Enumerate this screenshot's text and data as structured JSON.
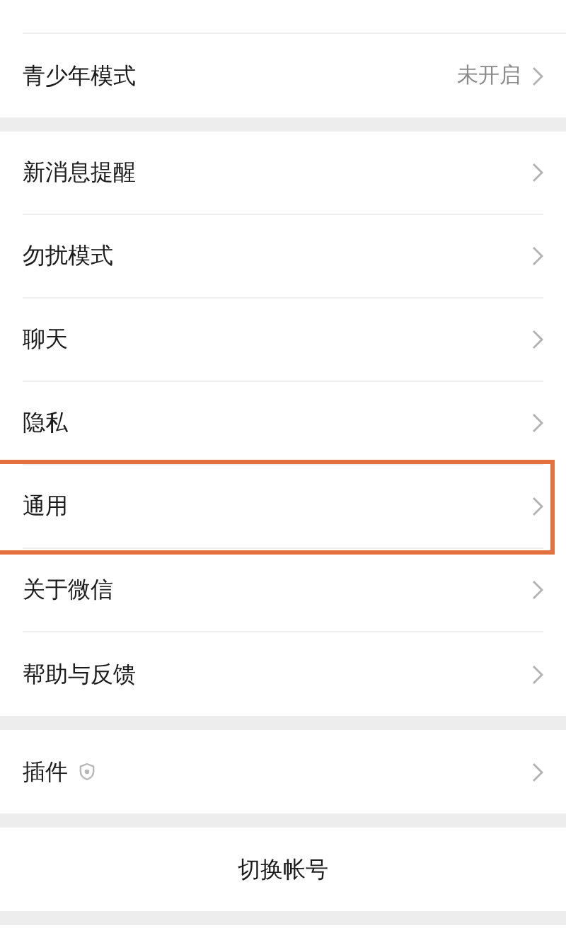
{
  "groups": [
    {
      "items": [
        {
          "kind": "link",
          "label": "青少年模式",
          "value": "未开启",
          "highlighted": false
        }
      ]
    },
    {
      "items": [
        {
          "kind": "link",
          "label": "新消息提醒",
          "highlighted": false
        },
        {
          "kind": "link",
          "label": "勿扰模式",
          "highlighted": false
        },
        {
          "kind": "link",
          "label": "聊天",
          "highlighted": false
        },
        {
          "kind": "link",
          "label": "隐私",
          "highlighted": false
        },
        {
          "kind": "link",
          "label": "通用",
          "highlighted": true
        },
        {
          "kind": "link",
          "label": "关于微信",
          "highlighted": false
        },
        {
          "kind": "link",
          "label": "帮助与反馈",
          "highlighted": false
        }
      ]
    },
    {
      "items": [
        {
          "kind": "plugin",
          "label": "插件",
          "highlighted": false
        }
      ]
    },
    {
      "items": [
        {
          "kind": "action",
          "label": "切换帐号",
          "highlighted": false
        }
      ]
    }
  ]
}
